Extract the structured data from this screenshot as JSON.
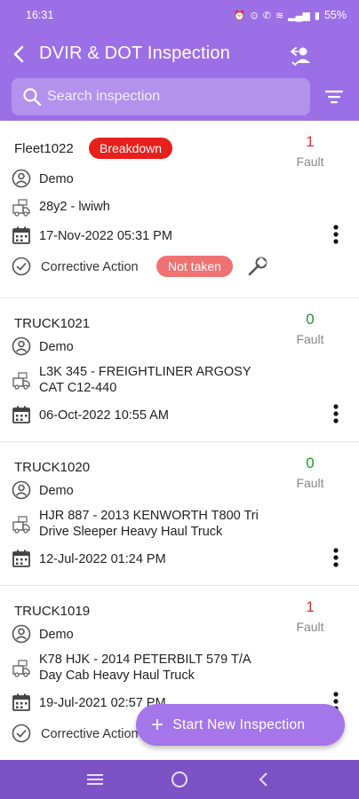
{
  "status_bar": {
    "time": "16:31",
    "battery": "55%"
  },
  "header": {
    "title": "DVIR & DOT Inspection"
  },
  "search": {
    "placeholder": "Search inspection"
  },
  "inspections": [
    {
      "unit": "Fleet1022",
      "badge": "Breakdown",
      "fault_count": "1",
      "fault_label": "Fault",
      "driver": "Demo",
      "vehicle": "28y2 - lwiwh",
      "date": "17-Nov-2022 05:31 PM",
      "corrective_label": "Corrective Action",
      "corrective_status": "Not taken"
    },
    {
      "unit": "TRUCK1021",
      "fault_count": "0",
      "fault_label": "Fault",
      "driver": "Demo",
      "vehicle_line1": "L3K 345 - FREIGHTLINER ARGOSY",
      "vehicle_line2": "CAT C12-440",
      "date": "06-Oct-2022 10:55 AM"
    },
    {
      "unit": "TRUCK1020",
      "fault_count": "0",
      "fault_label": "Fault",
      "driver": "Demo",
      "vehicle_line1": "HJR 887 - 2013 KENWORTH T800 Tri",
      "vehicle_line2": "Drive Sleeper Heavy Haul Truck",
      "date": "12-Jul-2022 01:24 PM"
    },
    {
      "unit": "TRUCK1019",
      "fault_count": "1",
      "fault_label": "Fault",
      "driver": "Demo",
      "vehicle_line1": "K78 HJK - 2014 PETERBILT 579 T/A",
      "vehicle_line2": "Day Cab Heavy Haul Truck",
      "date": "19-Jul-2021 02:57 PM",
      "corrective_label": "Corrective Action"
    }
  ],
  "fab": {
    "label": "Start New Inspection"
  },
  "colors": {
    "header": "#9d6fe6",
    "fault_red": "#e0313a",
    "fault_green": "#1c9b2a",
    "breakdown": "#e8201c",
    "not_taken": "#ef7272",
    "nav_bar": "#7c52c4"
  }
}
